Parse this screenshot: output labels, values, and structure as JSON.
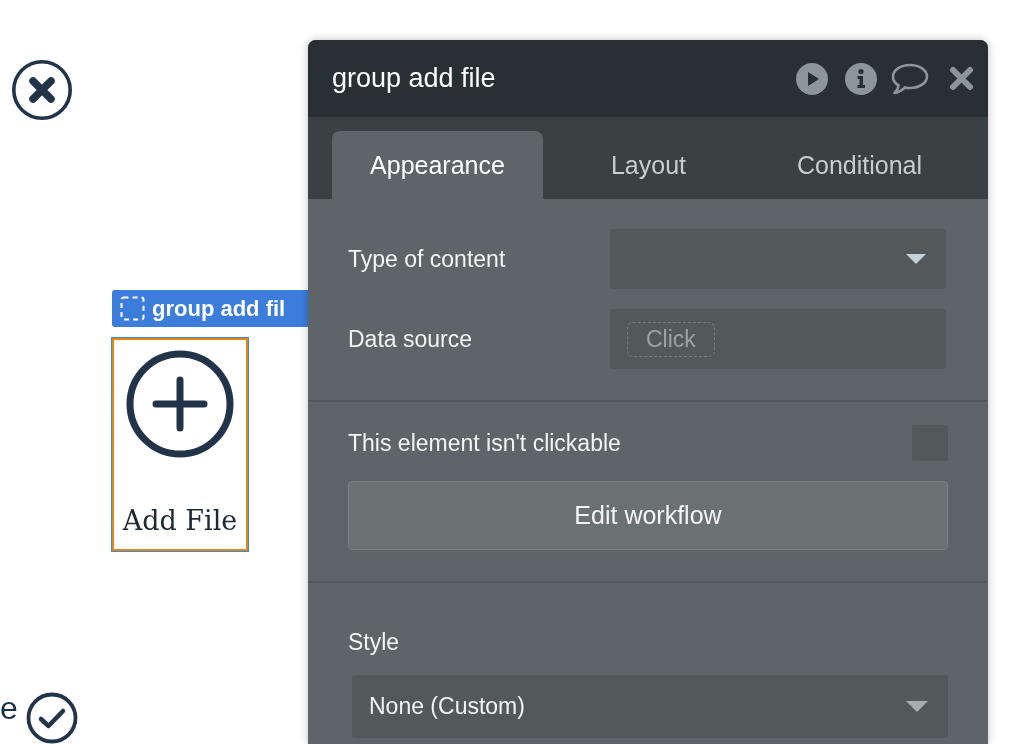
{
  "canvas": {
    "selection_label": {
      "text": "group add fil"
    },
    "group": {
      "text": "Add File"
    },
    "edge_text": "e"
  },
  "panel": {
    "title": "group add file",
    "tabs": [
      {
        "label": "Appearance",
        "selected": true
      },
      {
        "label": "Layout",
        "selected": false
      },
      {
        "label": "Conditional",
        "selected": false
      }
    ],
    "sections": [
      {
        "rows": [
          {
            "kind": "dropdown",
            "label": "Type of content"
          },
          {
            "kind": "dynamic",
            "label": "Data source",
            "chip": "Click"
          }
        ]
      },
      {
        "rows": [
          {
            "kind": "checkbox",
            "label": "This element isn't clickable",
            "checked": false
          },
          {
            "kind": "button",
            "label": "Edit workflow"
          }
        ]
      },
      {
        "rows": [
          {
            "kind": "select",
            "label": "Style",
            "value": "None (Custom)"
          }
        ]
      }
    ]
  }
}
